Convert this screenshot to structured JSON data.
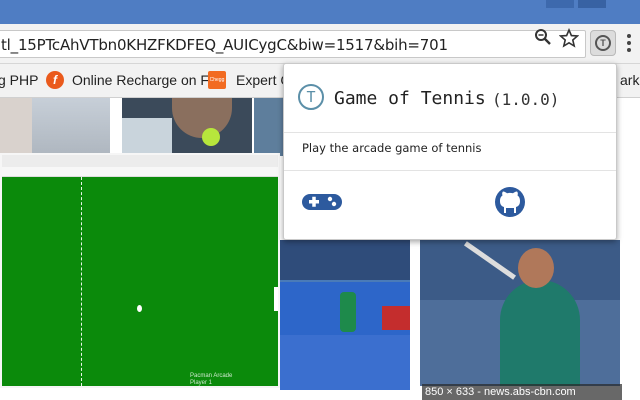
{
  "browser": {
    "url": "tl_15PTcAhVTbn0KHZFKDFEQ_AUICygC&biw=1517&bih=701",
    "icons": [
      "zoom-icon",
      "star-icon",
      "extension-icon",
      "menu-icon"
    ]
  },
  "bookmarks": [
    {
      "label": "g PHP",
      "icon": ""
    },
    {
      "label": "Online Recharge on F",
      "icon": "f"
    },
    {
      "label": "Expert C",
      "icon": "Chegg"
    },
    {
      "label": "ark",
      "icon": ""
    }
  ],
  "popup": {
    "logo": "T",
    "title": "Game of Tennis",
    "version": "(1.0.0)",
    "description": "Play the arcade game of tennis",
    "buttons": {
      "play": "gamepad-icon",
      "source": "github-icon"
    }
  },
  "game": {
    "watermark_line1": "Pacman Arcade",
    "watermark_line2": "Player 1"
  },
  "image_caption": "850 × 633 - news.abs-cbn.com",
  "colors": {
    "court": "#0b8a0b",
    "popup_accent": "#2d5a9e",
    "titlebar": "#4f7dc3"
  }
}
